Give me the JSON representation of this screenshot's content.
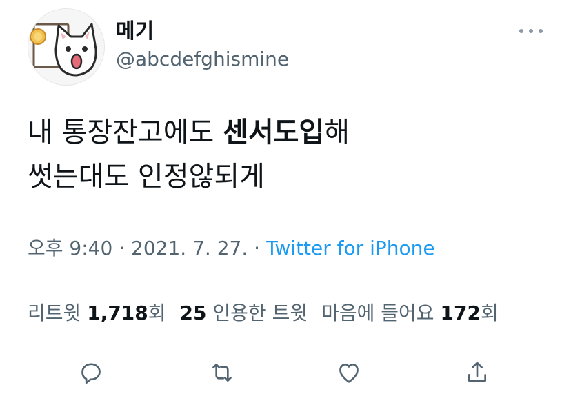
{
  "author": {
    "display_name": "메기",
    "handle": "@abcdefghismine",
    "avatar_icon": "cat-avatar-icon"
  },
  "tweet": {
    "line1_prefix": "내 통장잔고에도 ",
    "line1_bold": "센서도입",
    "line1_suffix": "해",
    "line2": "썻는대도 인정않되게"
  },
  "meta": {
    "time": "오후 9:40",
    "separator1": " · ",
    "date": "2021. 7. 27.",
    "separator2": " · ",
    "source": "Twitter for iPhone"
  },
  "stats": {
    "retweets_label": "리트윗",
    "retweets_count": "1,718",
    "retweets_suffix": "회",
    "quotes_count": "25",
    "quotes_label": "인용한 트윗",
    "likes_label": "마음에 들어요",
    "likes_count": "172",
    "likes_suffix": "회"
  },
  "actions": {
    "reply_icon": "reply-icon",
    "retweet_icon": "retweet-icon",
    "like_icon": "heart-icon",
    "share_icon": "share-icon"
  },
  "colors": {
    "text_primary": "#0f1419",
    "text_secondary": "#536471",
    "link": "#1d9bf0",
    "divider": "#cfd9de"
  }
}
